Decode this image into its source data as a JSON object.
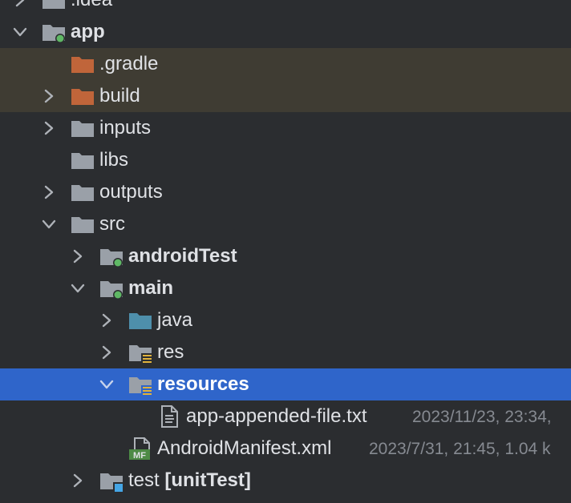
{
  "project_tree": {
    "items": [
      {
        "name": ".idea"
      },
      {
        "name": "app"
      },
      {
        "name": ".gradle"
      },
      {
        "name": "build"
      },
      {
        "name": "inputs"
      },
      {
        "name": "libs"
      },
      {
        "name": "outputs"
      },
      {
        "name": "src"
      },
      {
        "name": "androidTest"
      },
      {
        "name": "main"
      },
      {
        "name": "java"
      },
      {
        "name": "res"
      },
      {
        "name": "resources"
      },
      {
        "name": "app-appended-file.txt",
        "meta": "2023/11/23, 23:34,"
      },
      {
        "name": "AndroidManifest.xml",
        "meta": "2023/7/31, 21:45, 1.04 k"
      },
      {
        "name": "test",
        "suffix": "[unitTest]"
      }
    ],
    "manifest_badge": "MF"
  },
  "colors": {
    "background": "#2b2d30",
    "excluded_row": "#3f3c33",
    "selection": "#2f65ca",
    "folder_gray": "#9aa0a8",
    "folder_excluded": "#c0653a",
    "folder_source": "#4e8fab",
    "module_dot": "#5fb865",
    "resource_lines": "#e0b23c",
    "test_square": "#45a6e6",
    "meta_text": "#868a91"
  }
}
